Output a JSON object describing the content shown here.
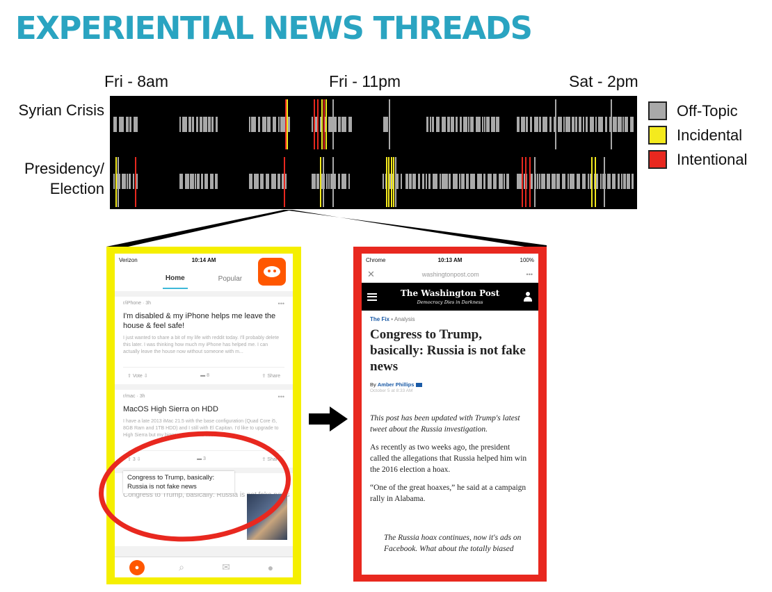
{
  "title": "EXPERIENTIAL NEWS THREADS",
  "timeline": {
    "time_labels": [
      "Fri - 8am",
      "Fri - 11pm",
      "Sat - 2pm"
    ],
    "rows": [
      {
        "label_line1": "Syrian Crisis",
        "label_line2": ""
      },
      {
        "label_line1": "Presidency/",
        "label_line2": "Election"
      }
    ],
    "colors": {
      "off_topic": "#a9a9a9",
      "incidental": "#f4ea1e",
      "intentional": "#e8281f"
    }
  },
  "legend": [
    {
      "label": "Off-Topic",
      "color": "#a9a9a9"
    },
    {
      "label": "Incidental",
      "color": "#f4ea1e"
    },
    {
      "label": "Intentional",
      "color": "#e8281f"
    }
  ],
  "reddit_phone": {
    "status_carrier": "Verizon",
    "status_time": "10:14 AM",
    "tabs": [
      "Home",
      "Popular"
    ],
    "posts": [
      {
        "meta": "r/iPhone · 3h",
        "title": "I'm disabled & my iPhone helps me leave the house & feel safe!",
        "body": "I just wanted to share a bit of my life with reddit today. I'll probably delete this later. I was thinking how much my iPhone has helped me. I can actually leave the house now without someone with m...",
        "votes": "Vote",
        "comments": "8",
        "share": "Share"
      },
      {
        "meta": "r/mac · 3h",
        "title": "MacOS High Sierra on HDD",
        "body": "I have a late 2013 iMac 21.5 with the base configuration (Quad Core i5, 8GB Ram and 1TB HDD) and I still with El Capitan. I'd like to upgrade to High Sierra but my biggest concern is about...",
        "votes": "3",
        "comments": "3",
        "share": "Share"
      }
    ],
    "highlighted_post": "Congress to Trump, basically: Russia is not fake news"
  },
  "wapo_phone": {
    "status_app": "Chrome",
    "status_time": "10:13 AM",
    "status_battery": "100%",
    "url": "washingtonpost.com",
    "masthead": "The Washington Post",
    "tagline": "Democracy Dies in Darkness",
    "section": "The Fix",
    "section_type": "Analysis",
    "headline": "Congress to Trump, basically: Russia is not fake news",
    "byline_prefix": "By",
    "author": "Amber Phillips",
    "date": "October 5 at 8:33 AM",
    "para1": "This post has been updated with Trump's latest tweet about the Russia investigation.",
    "para2": "As recently as two weeks ago, the president called the allegations that Russia helped him win the 2016 election a hoax.",
    "para3": "“One of the great hoaxes,” he said at a campaign rally in Alabama.",
    "quote": "The Russia hoax continues, now it's ads on Facebook. What about the totally biased"
  }
}
